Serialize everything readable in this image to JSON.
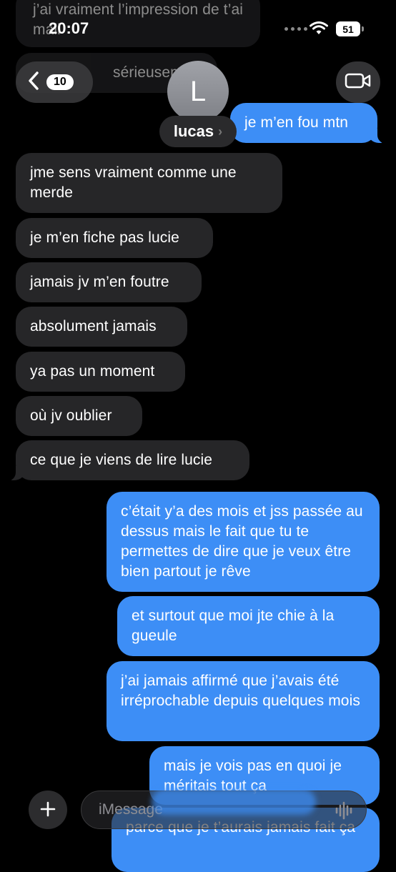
{
  "status": {
    "time": "20:07",
    "battery": "51"
  },
  "nav": {
    "unread_count": "10",
    "contact_initial": "L",
    "contact_name": "lucas"
  },
  "background_messages": [
    {
      "text": "j’ai vraiment l’impression de t’ai mali"
    },
    {
      "text": "sérieusem"
    }
  ],
  "messages": [
    {
      "type": "sent",
      "text": "je m’en fou mtn"
    },
    {
      "type": "received",
      "text": "jme sens vraiment comme une merde"
    },
    {
      "type": "received",
      "text": "je m’en fiche pas lucie"
    },
    {
      "type": "received",
      "text": "jamais jv m’en foutre"
    },
    {
      "type": "received",
      "text": "absolument jamais"
    },
    {
      "type": "received",
      "text": "ya pas un moment"
    },
    {
      "type": "received",
      "text": "où jv oublier"
    },
    {
      "type": "received",
      "text": "ce que je viens de lire lucie"
    },
    {
      "type": "sent",
      "text": "c’était y’a des mois et jss passée au dessus mais le fait que tu te permettes de dire que je veux être bien partout je rêve"
    },
    {
      "type": "sent",
      "text": "et surtout que moi jte chie à la gueule"
    },
    {
      "type": "sent",
      "text": "j’ai jamais affirmé que j’avais été irréprochable depuis quelques mois"
    },
    {
      "type": "sent",
      "text": "mais je vois pas en quoi je méritais tout ça"
    },
    {
      "type": "sent",
      "text": "parce que je t’aurais jamais fait ça"
    }
  ],
  "composer": {
    "placeholder": "iMessage"
  },
  "colors": {
    "sent": "#3d8ef6",
    "received": "#262628",
    "background": "#000000"
  }
}
